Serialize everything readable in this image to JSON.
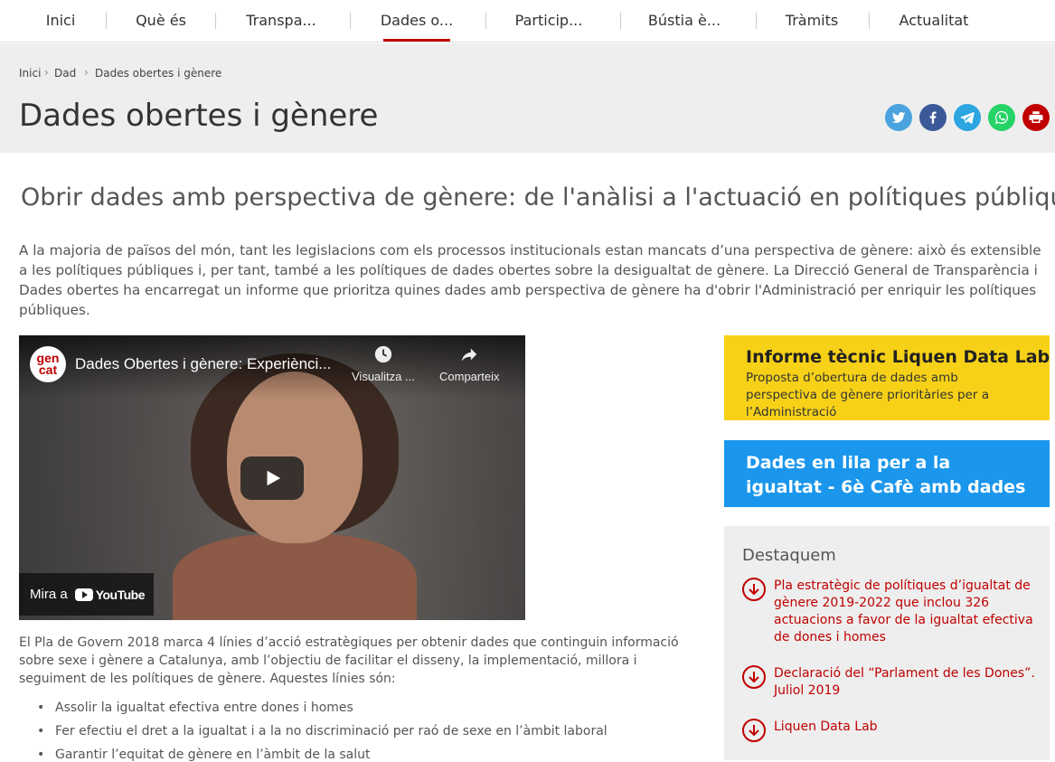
{
  "nav": {
    "items": [
      {
        "label": "Inici"
      },
      {
        "label": "Què és"
      },
      {
        "label": "Transpa..."
      },
      {
        "label": "Dades o..."
      },
      {
        "label": "Particip..."
      },
      {
        "label": "Bústia è..."
      },
      {
        "label": "Tràmits"
      },
      {
        "label": "Actualitat"
      }
    ],
    "active_index": 3,
    "accent_color": "#c00000"
  },
  "breadcrumb": {
    "items": [
      "Inici",
      "Dad",
      "Dades obertes i gènere"
    ]
  },
  "page_title": "Dades obertes i gènere",
  "share": {
    "icons": [
      "twitter-icon",
      "facebook-icon",
      "telegram-icon",
      "whatsapp-icon",
      "print-icon"
    ],
    "colors": [
      "#4aa3df",
      "#3b5998",
      "#2ca5e0",
      "#25d366",
      "#c00000"
    ]
  },
  "subtitle": "Obrir dades amb perspectiva de gènere: de l'anàlisi a l'actuació en polítiques públiques",
  "intro": "A la majoria de països del món, tant les legislacions com els processos institucionals estan mancats d’una perspectiva de gènere: això és extensible a les polítiques públiques i, per tant, també a les polítiques de dades obertes sobre la desigualtat de gènere. La Direcció General de Transparència i Dades obertes ha encarregat un informe que prioritza quines dades amb perspectiva de gènere ha d'obrir l'Administració per enriquir les polítiques públiques.",
  "video": {
    "channel_logo": "gen cat",
    "title": "Dades Obertes i gènere: Experiènci...",
    "watch_later": "Visualitza ...",
    "share": "Comparteix",
    "watch_on": "Mira a",
    "youtube": "YouTube"
  },
  "body_text": "El Pla de Govern 2018 marca 4 línies d’acció estratègiques per obtenir dades que continguin informació sobre sexe i  gènere a Catalunya, amb l’objectiu de facilitar el disseny, la implementació, millora i seguiment de les polítiques de gènere. Aquestes línies són:",
  "bullets": [
    "Assolir la igualtat efectiva entre dones i homes",
    "Fer efectiu el dret a la igualtat i a la no discriminació per raó de sexe en l’àmbit laboral",
    "Garantir l’equitat de gènere en l’àmbit de la salut"
  ],
  "cards": {
    "yellow": {
      "title": "Informe tècnic Liquen Data Lab",
      "subtitle": "Proposta d’obertura de dades amb perspectiva de gènere prioritàries per a l’Administració",
      "color": "#f7d117"
    },
    "blue": {
      "title": "Dades en lila per a la igualtat - 6è Cafè amb dades",
      "color": "#1a96ec"
    }
  },
  "destaquem": {
    "heading": "Destaquem",
    "links": [
      "Pla estratègic de polítiques d’igualtat de gènere 2019-2022 que inclou 326 actuacions a favor de la igualtat efectiva de dones i homes",
      "Declaració del “Parlament de les Dones”. Juliol 2019",
      "Liquen Data Lab"
    ]
  }
}
